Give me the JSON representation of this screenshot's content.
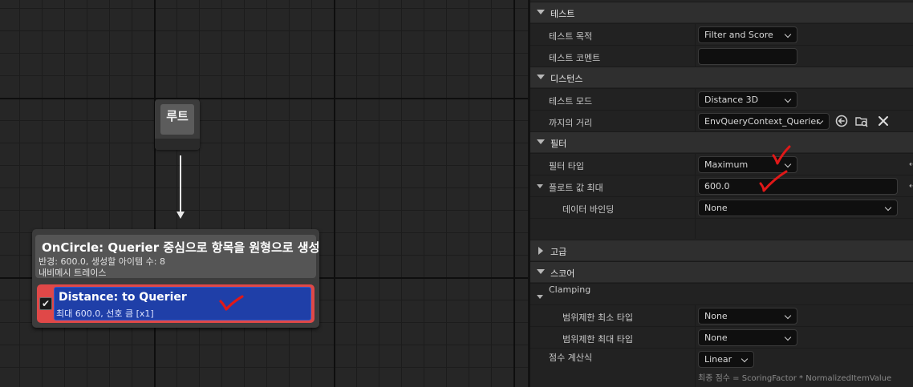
{
  "graph": {
    "root_node": {
      "label": "루트"
    },
    "generator_node": {
      "title": "OnCircle: Querier 중심으로 항목을 원형으로 생성",
      "subtitle_line1": "반경: 600.0, 생성할 아이템 수: 8",
      "subtitle_line2": "내비메시 트레이스",
      "test": {
        "checked": true,
        "title": "Distance: to Querier",
        "subtitle": "최대 600.0, 선호 큼 [x1]"
      }
    }
  },
  "details": {
    "sections": {
      "test": "테스트",
      "distance": "디스턴스",
      "filter": "필터",
      "advanced": "고급",
      "score": "스코어"
    },
    "rows": {
      "test_purpose": {
        "label": "테스트 목적",
        "value": "Filter and Score"
      },
      "test_comment": {
        "label": "테스트 코멘트",
        "value": ""
      },
      "test_mode": {
        "label": "테스트 모드",
        "value": "Distance 3D"
      },
      "distance_to": {
        "label": "까지의 거리",
        "value": "EnvQueryContext_Querier"
      },
      "filter_type": {
        "label": "필터 타입",
        "value": "Maximum"
      },
      "float_max": {
        "label": "플로트 값 최대",
        "value": "600.0"
      },
      "data_binding": {
        "label": "데이터 바인딩",
        "value": "None"
      },
      "clamping": {
        "label": "Clamping"
      },
      "clamp_min_type": {
        "label": "범위제한 최소 타입",
        "value": "None"
      },
      "clamp_max_type": {
        "label": "범위제한 최대 타입",
        "value": "None"
      },
      "scoring_equation": {
        "label": "점수 계산식",
        "value": "Linear"
      }
    },
    "score_hint": "최종 점수 = ScoringFactor * NormalizedItemValue",
    "reset_arrow": "⇠"
  },
  "colors": {
    "annotation_red": "#e01818",
    "test_node_red": "#e04848",
    "test_inner_blue": "#1f3fa8"
  }
}
